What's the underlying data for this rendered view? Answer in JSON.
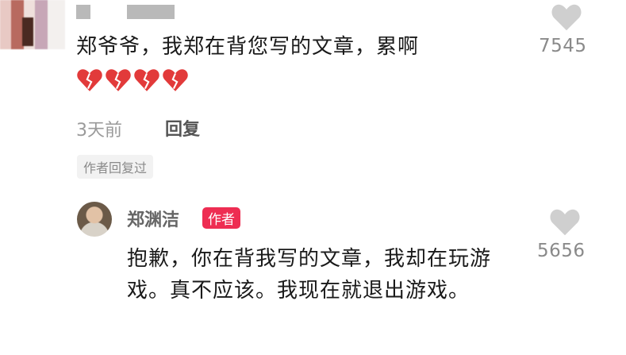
{
  "comment": {
    "text": "郑爷爷，我郑在背您写的文章，累啊",
    "likes": "7545",
    "time": "3天前",
    "reply_label": "回复",
    "author_replied_badge": "作者回复过"
  },
  "reply": {
    "author_name": "郑渊洁",
    "author_tag": "作者",
    "text": "抱歉，你在背我写的文章，我却在玩游戏。真不应该。我现在就退出游戏。",
    "likes": "5656"
  },
  "icons": {
    "like": "heart-outline-icon",
    "emoji": "broken-heart-icon"
  },
  "colors": {
    "author_tag": "#ee2d52",
    "broken_heart": "#e23a3a",
    "like_icon": "#cfcfcf"
  }
}
